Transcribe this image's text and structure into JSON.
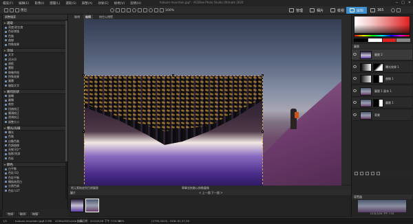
{
  "menu": [
    "檔案(F)",
    "編輯(E)",
    "影像(I)",
    "圖層(L)",
    "選取(S)",
    "調整(A)",
    "效果(E)",
    "檢視(V)",
    "說明(H)"
  ],
  "window_title": "hobuan-mountain.jpg* - ACDSee Photo Studio Ultimate 2020",
  "window_controls": [
    "─",
    "□",
    "✕"
  ],
  "toolbar": {
    "export_label": "匯出",
    "zoom_label": "100%",
    "modes": [
      "管理",
      "相片",
      "檢視",
      "編輯",
      "365"
    ],
    "active_mode": "編輯"
  },
  "canvas_tabs": [
    "檢視",
    "編輯",
    "按住以預覽"
  ],
  "left_panel": {
    "header": "調整檔案",
    "sections": [
      {
        "title": "選取",
        "items": [
          "亮度/對比度",
          "色彩增強",
          "色階",
          "曲線",
          "特殊效果"
        ]
      },
      {
        "title": "添加",
        "items": [
          "文字",
          "浮水印",
          "邊框",
          "暈影",
          "移軸特效",
          "特殊效果",
          "圖畫",
          "繪製文字"
        ]
      },
      {
        "title": "幾何形狀",
        "items": [
          "旋轉",
          "翻轉",
          "裁剪",
          "扭曲校正",
          "鏡頭校正",
          "透視校正",
          "調整大小"
        ]
      },
      {
        "title": "曝光/光線",
        "items": [
          "曝光",
          "色階",
          "自動色階",
          "色調曲線",
          "光線 EQ™",
          "陰影/亮部",
          "色彩"
        ]
      },
      {
        "title": "顏色",
        "items": [
          "白平衡",
          "色彩 EQ",
          "色彩平衡",
          "轉換為黑白",
          "分割色調",
          "色彩 LUT"
        ]
      }
    ],
    "buttons": [
      "完成",
      "取消",
      "恢復"
    ]
  },
  "canvas_status_left": "將元素拖放到目標圖層",
  "canvas_status_center": "單擊並拖動以移動圖像",
  "layers": {
    "header": "圖層",
    "items": [
      {
        "name": "圖層 2",
        "selected": true
      },
      {
        "name": "曝光效果 1",
        "selected": false
      },
      {
        "name": "曲線 1",
        "selected": false
      },
      {
        "name": "圖層 1 副本 1",
        "selected": false
      },
      {
        "name": "圖層 1",
        "selected": false
      },
      {
        "name": "背景",
        "selected": false
      }
    ]
  },
  "navigator": {
    "header": "導覽器",
    "info": "2015/5/26 下午 7:35"
  },
  "bottom_tab": "圖片",
  "filmstrip_label": "< 上一個  下一個 >",
  "statusbar": {
    "index": "1/2",
    "filename": "hobuan-mountain.jpg",
    "filesize": "3.5 MB",
    "dimensions": "4256x2832x24b jpeg",
    "date": "拍攝日期：2015/5/26 下午 7:35:36",
    "zoom": "28%",
    "coords": "(2795,3423) - RGB: 81,37,36"
  },
  "colors": {
    "accent": "#3d8fd0",
    "selection_handle": "#e8c060"
  }
}
